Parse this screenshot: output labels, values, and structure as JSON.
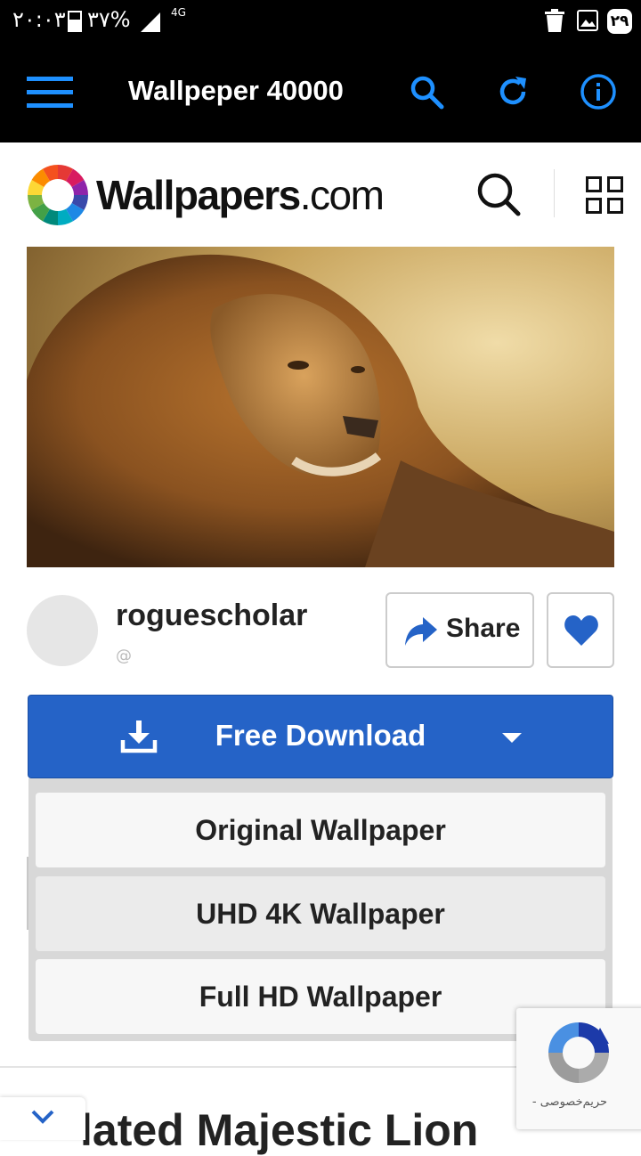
{
  "status_bar": {
    "time": "۲۰:۰۳",
    "battery": "۳۷%",
    "network": "4G",
    "date": "۲۹",
    "icons": [
      "battery-icon",
      "signal-icon",
      "trash-icon",
      "gallery-icon"
    ]
  },
  "app_bar": {
    "title": "Wallpeper 40000",
    "accent_color": "#1e90ff",
    "icons": [
      "menu-icon",
      "search-icon",
      "refresh-icon",
      "info-icon"
    ]
  },
  "site": {
    "logo_main": "Wallpapers",
    "logo_suffix": ".com",
    "icons": [
      "site-search-icon",
      "grid-icon"
    ]
  },
  "wallpaper": {
    "author": "roguescholar",
    "handle": "@"
  },
  "actions": {
    "share_label": "Share",
    "favorite_icon": "heart-icon",
    "favorite_color": "#2563c7"
  },
  "download": {
    "label": "Free Download",
    "color": "#2563c7",
    "options": [
      "Original Wallpaper",
      "UHD 4K Wallpaper",
      "Full HD Wallpaper"
    ]
  },
  "related": {
    "title": "lated Majestic Lion"
  },
  "recaptcha": {
    "privacy_text": "حریم‌خصوصی -"
  }
}
